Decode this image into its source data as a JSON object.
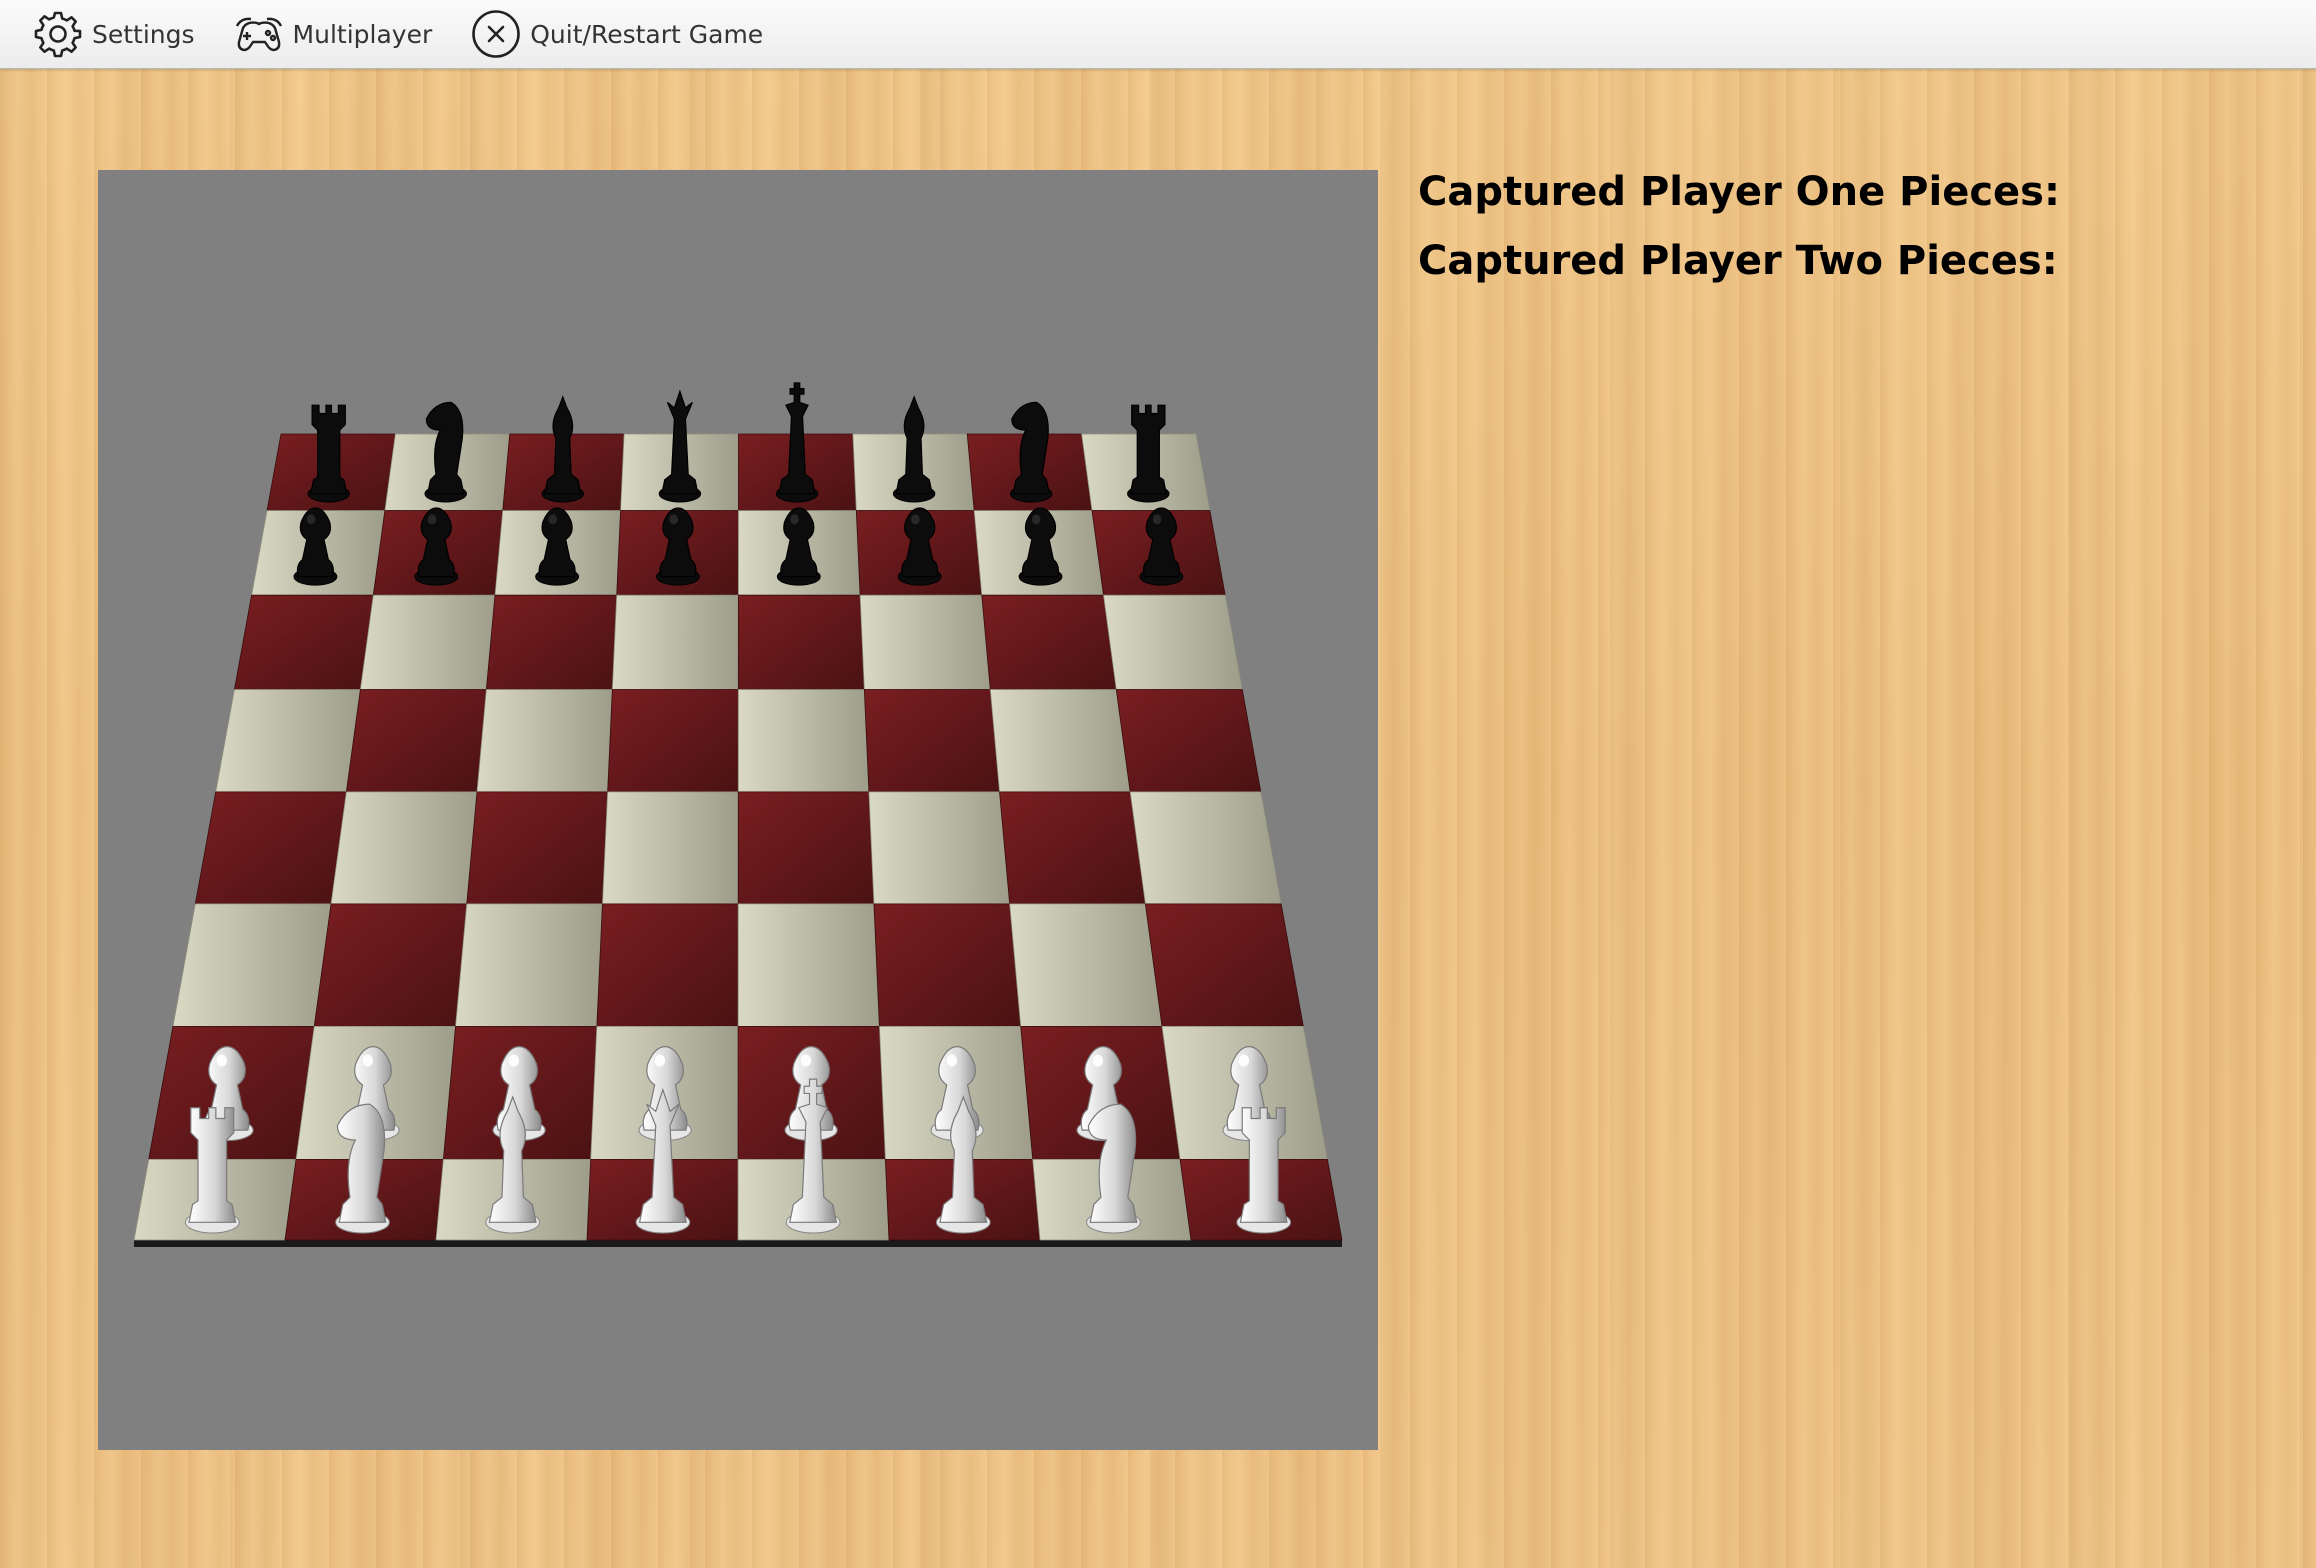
{
  "menu": {
    "items": [
      {
        "id": "settings",
        "label": "Settings",
        "icon": "gear-icon"
      },
      {
        "id": "multiplayer",
        "label": "Multiplayer",
        "icon": "gamepad-icon"
      },
      {
        "id": "quit",
        "label": "Quit/Restart Game",
        "icon": "close-circle-icon"
      }
    ]
  },
  "captured": {
    "player_one_label": "Captured Player One Pieces:",
    "player_two_label": "Captured Player Two Pieces:",
    "player_one_pieces": [],
    "player_two_pieces": []
  },
  "board": {
    "rows": 8,
    "cols": 8,
    "colors": {
      "panel_bg": "#808080",
      "dark_square": "#6a1a1c",
      "light_square": "#c9c9b0",
      "black_piece": "#0c0c0c",
      "white_piece": "#f2f2f2"
    },
    "position": [
      [
        "r",
        "n",
        "b",
        "q",
        "k",
        "b",
        "n",
        "r"
      ],
      [
        "p",
        "p",
        "p",
        "p",
        "p",
        "p",
        "p",
        "p"
      ],
      [
        "",
        "",
        "",
        "",
        "",
        "",
        "",
        ""
      ],
      [
        "",
        "",
        "",
        "",
        "",
        "",
        "",
        ""
      ],
      [
        "",
        "",
        "",
        "",
        "",
        "",
        "",
        ""
      ],
      [
        "",
        "",
        "",
        "",
        "",
        "",
        "",
        ""
      ],
      [
        "P",
        "P",
        "P",
        "P",
        "P",
        "P",
        "P",
        "P"
      ],
      [
        "R",
        "N",
        "B",
        "Q",
        "K",
        "B",
        "N",
        "R"
      ]
    ]
  }
}
